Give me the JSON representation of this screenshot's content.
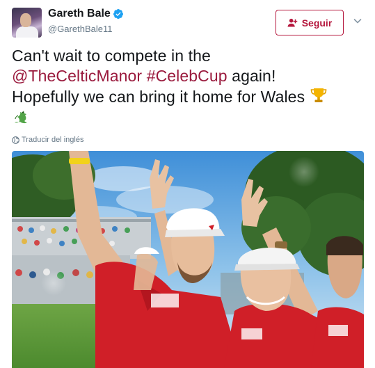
{
  "author": {
    "name": "Gareth Bale",
    "handle": "@GarethBale11",
    "avatar_icon": "profile-photo",
    "verified_icon": "verified-badge-icon"
  },
  "actions": {
    "follow_label": "Seguir",
    "follow_icon": "add-user-icon",
    "menu_icon": "chevron-down-icon"
  },
  "tweet": {
    "line1": "Can't wait to compete in the",
    "mention": "@TheCelticManor",
    "hashtag": "#CelebCup",
    "line2_rest": "again!",
    "line3": "Hopefully we can bring it home for Wales",
    "emojis": [
      "trophy-emoji",
      "dragon-emoji"
    ]
  },
  "translate": {
    "label": "Traducir del inglés",
    "icon": "globe-icon"
  },
  "media": {
    "type": "photo",
    "icon": "golfers-celebrating-photo"
  },
  "colors": {
    "accent": "#9a1a3d",
    "follow_border": "#b5173d",
    "verified": "#1da1f2",
    "muted": "#657786"
  }
}
